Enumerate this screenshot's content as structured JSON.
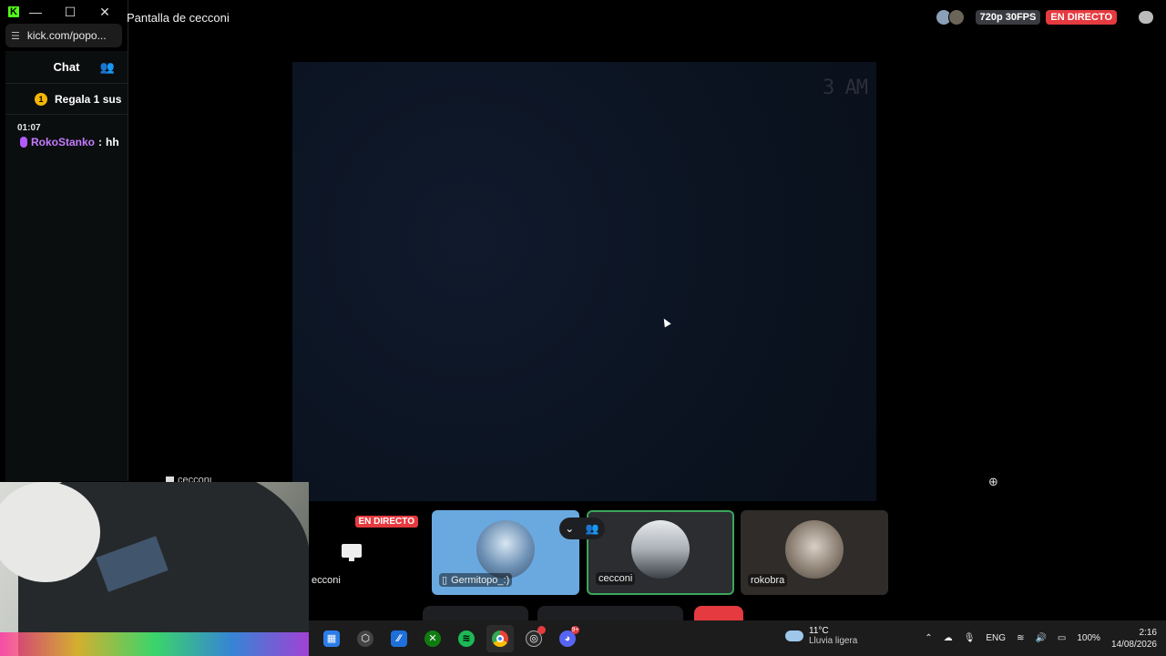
{
  "kick_window": {
    "url": "kick.com/popo...",
    "window_controls": {
      "minimize": "—",
      "maximize": "☐",
      "close": "✕"
    },
    "chat_header": "Chat",
    "gift_coin": "1",
    "gift_label": "Regala 1 sus",
    "messages": [
      {
        "time": "01:07",
        "user": "RokoStanko",
        "separator": ":",
        "text": "hh"
      }
    ]
  },
  "stream": {
    "title": "Pantalla de cecconi",
    "quality": "720p 30FPS",
    "live_label": "EN DIRECTO",
    "overlay_time": "3 AM",
    "webcam_label": "cecconi"
  },
  "tiles": [
    {
      "name": "ecconi",
      "live_label": "EN DIRECTO"
    },
    {
      "name": "Germitopo_:)"
    },
    {
      "name": "cecconi"
    },
    {
      "name": "rokobra"
    }
  ],
  "taskbar": {
    "weather": {
      "temp": "11°C",
      "desc": "Lluvia ligera"
    },
    "discord_badge": "9+",
    "language": "ENG",
    "battery": "100%",
    "time": "2:16",
    "date": "14/08/2026"
  },
  "colors": {
    "kick_green": "#53fc18",
    "live_red": "#e53a3f",
    "speaking_green": "#3ba55c"
  }
}
